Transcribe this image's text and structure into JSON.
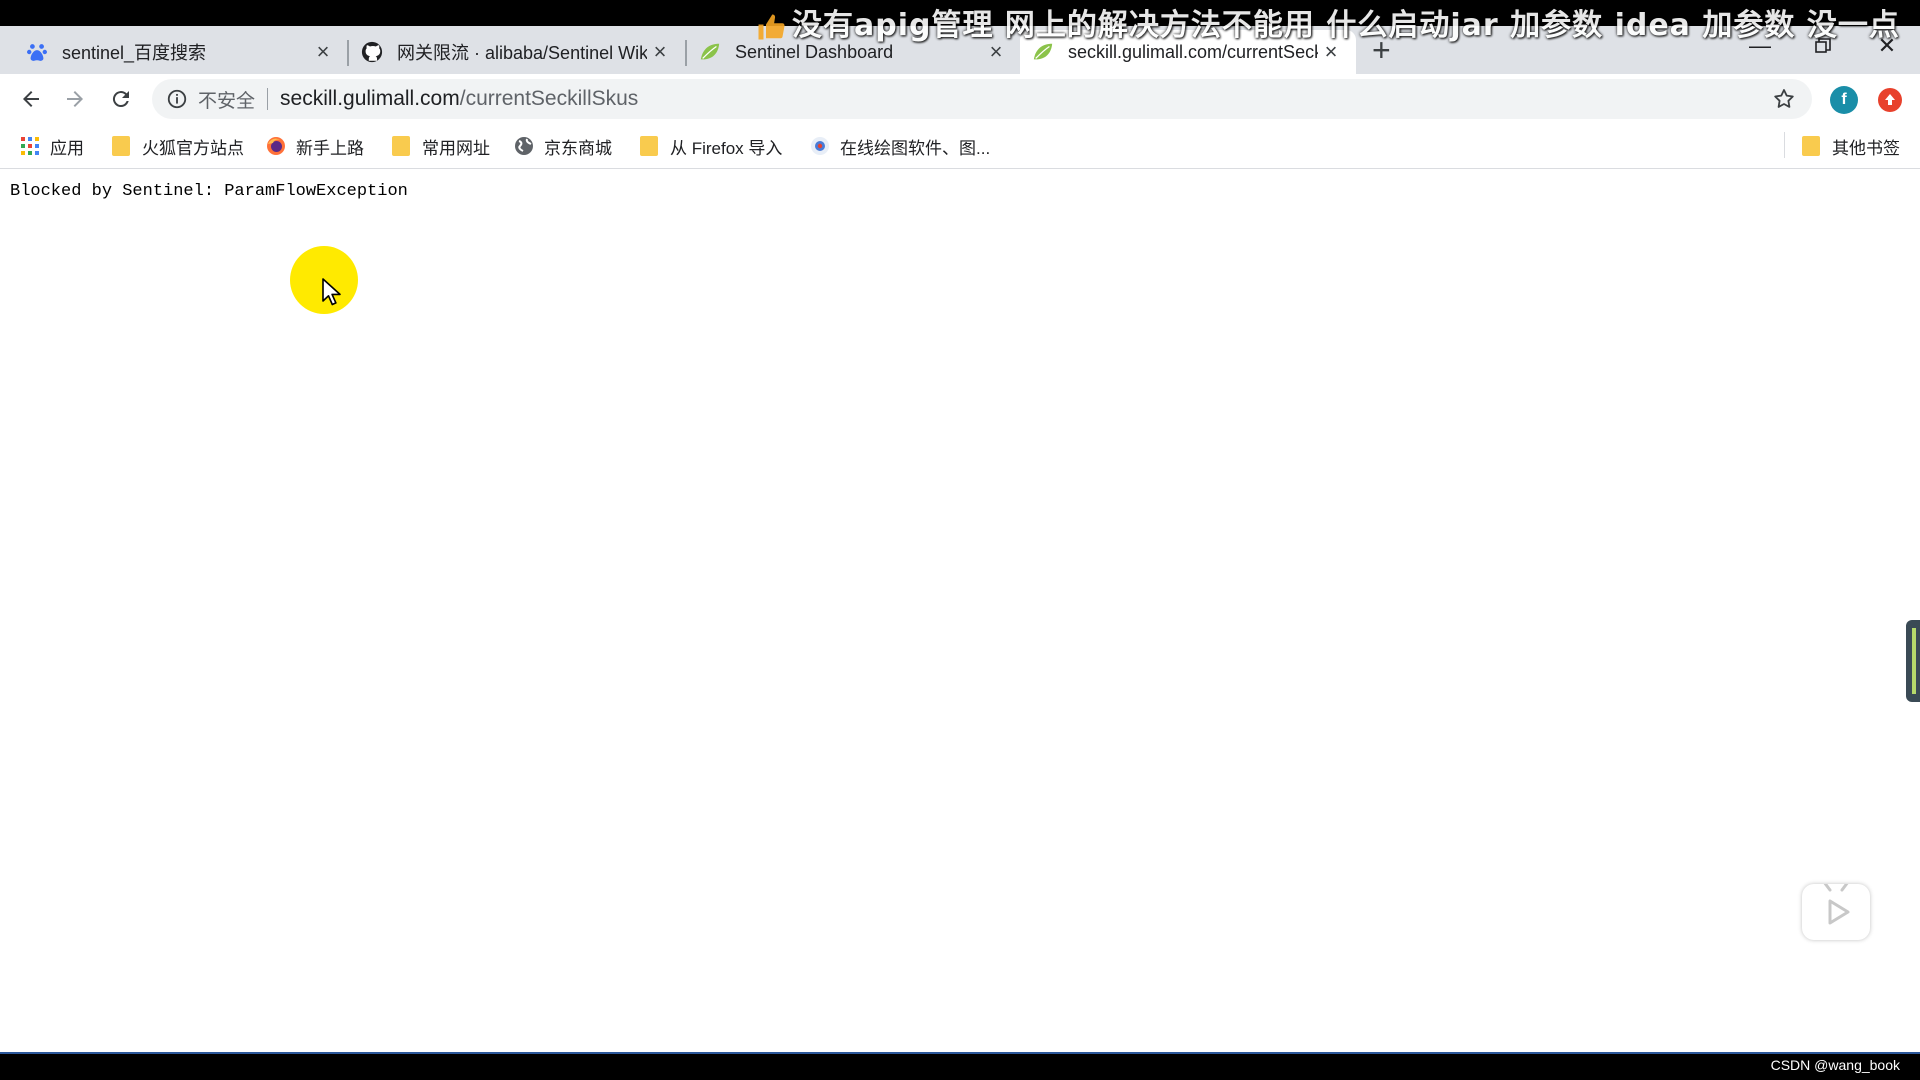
{
  "overlay": {
    "danmaku": "没有apig管理  网上的解决方法不能用  什么启动jar  加参数   idea  加参数  没一点"
  },
  "tabs": [
    {
      "title": "sentinel_百度搜索",
      "favicon": "baidu-paw-icon",
      "active": false
    },
    {
      "title": "网关限流 · alibaba/Sentinel Wiki",
      "favicon": "github-icon",
      "active": false
    },
    {
      "title": "Sentinel Dashboard",
      "favicon": "sentinel-leaf-icon",
      "active": false
    },
    {
      "title": "seckill.gulimall.com/currentSeckillSkus",
      "favicon": "sentinel-leaf-icon",
      "active": true
    }
  ],
  "toolbar": {
    "security_label": "不安全",
    "url_host": "seckill.gulimall.com",
    "url_path": "/currentSeckillSkus",
    "profile_letter": "f"
  },
  "bookmarks": {
    "apps_label": "应用",
    "items": [
      {
        "label": "火狐官方站点",
        "icon": "folder-icon"
      },
      {
        "label": "新手上路",
        "icon": "firefox-icon"
      },
      {
        "label": "常用网址",
        "icon": "folder-icon"
      },
      {
        "label": "京东商城",
        "icon": "globe-icon"
      },
      {
        "label": "从 Firefox 导入",
        "icon": "folder-icon"
      },
      {
        "label": "在线绘图软件、图...",
        "icon": "processon-icon"
      }
    ],
    "other_label": "其他书签"
  },
  "page": {
    "message": "Blocked by Sentinel: ParamFlowException"
  },
  "footer": {
    "watermark": "CSDN @wang_book"
  }
}
